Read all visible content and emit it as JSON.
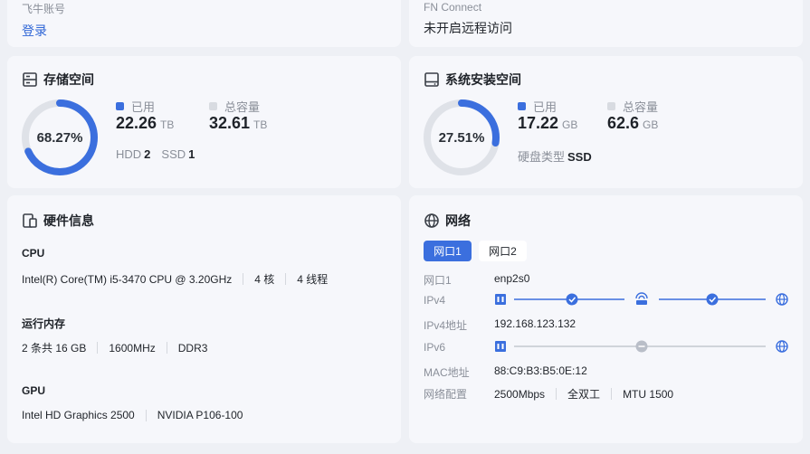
{
  "account": {
    "label": "飞牛账号",
    "action": "登录"
  },
  "fn_connect": {
    "label": "FN Connect",
    "status": "未开启远程访问"
  },
  "storage": {
    "title": "存储空间",
    "percent_text": "68.27%",
    "percent": 0.6827,
    "used_label": "已用",
    "used_value": "22.26",
    "used_unit": "TB",
    "total_label": "总容量",
    "total_value": "32.61",
    "total_unit": "TB",
    "hdd_label": "HDD",
    "hdd_count": "2",
    "ssd_label": "SSD",
    "ssd_count": "1",
    "accent": "#3b6fde",
    "track": "#dfe2e8"
  },
  "system": {
    "title": "系统安装空间",
    "percent_text": "27.51%",
    "percent": 0.2751,
    "used_label": "已用",
    "used_value": "17.22",
    "used_unit": "GB",
    "total_label": "总容量",
    "total_value": "62.6",
    "total_unit": "GB",
    "disk_type_label": "硬盘类型",
    "disk_type_value": "SSD"
  },
  "hardware": {
    "title": "硬件信息",
    "cpu": {
      "heading": "CPU",
      "model": "Intel(R) Core(TM) i5-3470 CPU @ 3.20GHz",
      "cores": "4 核",
      "threads": "4 线程"
    },
    "memory": {
      "heading": "运行内存",
      "count": "2 条共 16 GB",
      "speed": "1600MHz",
      "type": "DDR3"
    },
    "gpu": {
      "heading": "GPU",
      "gpu1": "Intel HD Graphics 2500",
      "gpu2": "NVIDIA P106-100"
    }
  },
  "network": {
    "title": "网络",
    "tabs": [
      {
        "label": "网口1"
      },
      {
        "label": "网口2"
      }
    ],
    "port_label": "网口1",
    "port_value": "enp2s0",
    "ipv4_label": "IPv4",
    "ipv4_addr_label": "IPv4地址",
    "ipv4_addr_value": "192.168.123.132",
    "ipv6_label": "IPv6",
    "mac_label": "MAC地址",
    "mac_value": "88:C9:B3:B5:0E:12",
    "config_label": "网络配置",
    "speed": "2500Mbps",
    "duplex": "全双工",
    "mtu": "MTU 1500",
    "connected_color": "#3b6fde",
    "disconnected_color": "#b9bec8"
  }
}
